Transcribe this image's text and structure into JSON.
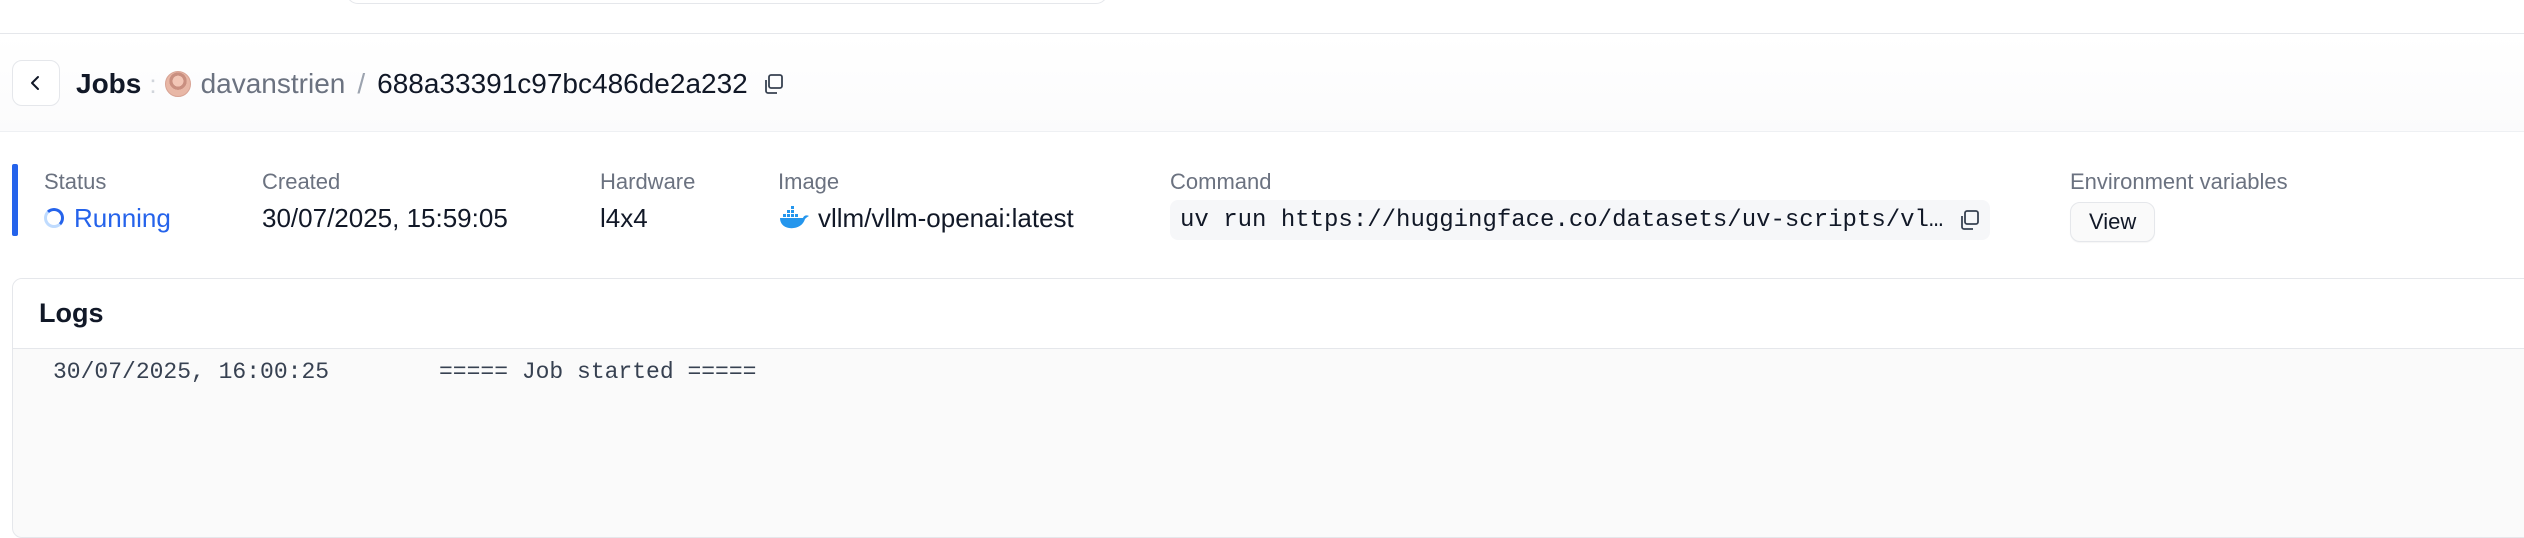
{
  "header": {
    "title": "Jobs",
    "separator": ":",
    "user": "davanstrien",
    "slash": "/",
    "job_id": "688a33391c97bc486de2a232"
  },
  "status": {
    "status_label": "Status",
    "status_value": "Running",
    "created_label": "Created",
    "created_value": "30/07/2025, 15:59:05",
    "hardware_label": "Hardware",
    "hardware_value": "l4x4",
    "image_label": "Image",
    "image_value": "vllm/vllm-openai:latest",
    "command_label": "Command",
    "command_value": "uv run https://huggingface.co/datasets/uv-scripts/vl…",
    "env_label": "Environment variables",
    "env_button": "View"
  },
  "logs": {
    "title": "Logs",
    "entries": [
      {
        "time": "30/07/2025, 16:00:25",
        "message": "===== Job started ====="
      }
    ]
  },
  "colors": {
    "accent": "#2563eb",
    "docker_blue": "#2496ed"
  },
  "icons": [
    "chevron-left-icon",
    "user-avatar",
    "copy-icon",
    "spinner-icon",
    "docker-icon"
  ]
}
